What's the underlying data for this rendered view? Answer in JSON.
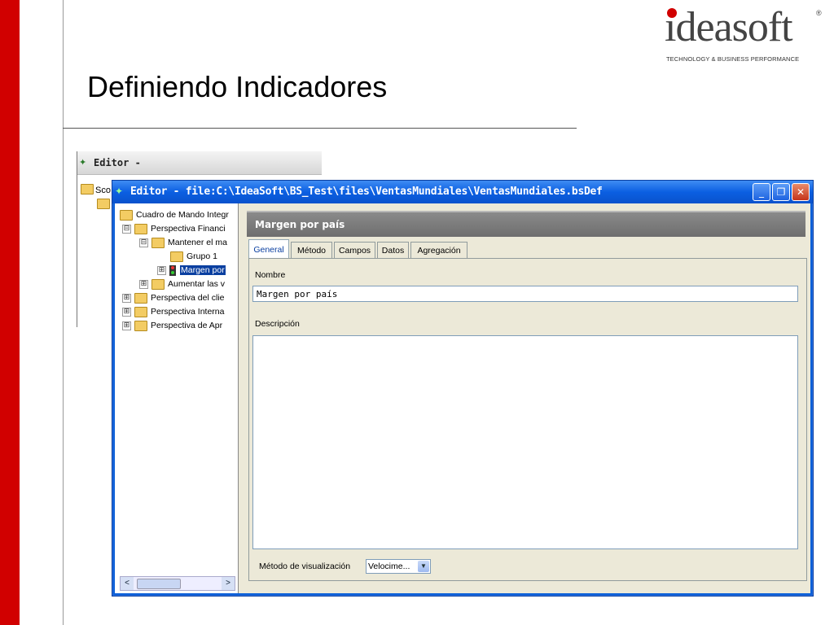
{
  "slide": {
    "title": "Definiendo Indicadores"
  },
  "logo": {
    "name": "ideasoft",
    "registered": "®",
    "tagline": "TECHNOLOGY & BUSINESS PERFORMANCE",
    "accent_color": "#d10000"
  },
  "background_window": {
    "title": "Editor -",
    "tree_label": "Sco"
  },
  "window": {
    "title": "Editor - file:C:\\IdeaSoft\\BS_Test\\files\\VentasMundiales\\VentasMundiales.bsDef",
    "icon": "editor-icon",
    "controls": [
      "minimize-icon",
      "maximize-icon",
      "close-icon"
    ]
  },
  "tree": {
    "items": [
      {
        "label": "Cuadro de Mando Integr",
        "expander": ""
      },
      {
        "label": "Perspectiva Financi",
        "expander": "⊟"
      },
      {
        "label": "Mantener el ma",
        "expander": "⊟"
      },
      {
        "label": "Grupo 1",
        "expander": ""
      },
      {
        "label": "Margen por",
        "expander": "⊞"
      },
      {
        "label": "Aumentar las v",
        "expander": "⊞"
      },
      {
        "label": "Perspectiva del clie",
        "expander": "⊞"
      },
      {
        "label": "Perspectiva Interna",
        "expander": "⊞"
      },
      {
        "label": "Perspectiva de Apr",
        "expander": "⊞"
      }
    ],
    "scroll_left": "<",
    "scroll_right": ">"
  },
  "panel": {
    "header": "Margen por país",
    "tabs": [
      "General",
      "Método",
      "Campos",
      "Datos",
      "Agregación"
    ],
    "active_tab": "General",
    "nombre_label": "Nombre",
    "nombre_value": "Margen por país",
    "descripcion_label": "Descripción",
    "descripcion_value": "",
    "metodo_label": "Método de visualización",
    "metodo_value": "Velocime..."
  }
}
